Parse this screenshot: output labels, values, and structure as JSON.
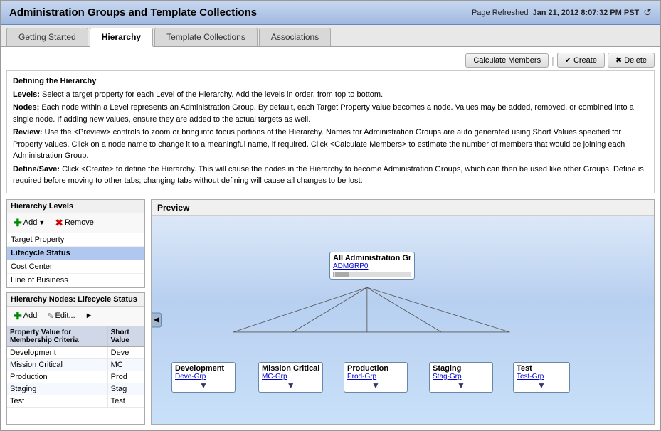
{
  "titleBar": {
    "title": "Administration Groups and Template Collections",
    "pageRefreshed": "Page Refreshed",
    "timestamp": "Jan 21, 2012  8:07:32 PM PST"
  },
  "tabs": [
    {
      "id": "getting-started",
      "label": "Getting Started",
      "active": false
    },
    {
      "id": "hierarchy",
      "label": "Hierarchy",
      "active": true
    },
    {
      "id": "template-collections",
      "label": "Template Collections",
      "active": false
    },
    {
      "id": "associations",
      "label": "Associations",
      "active": false
    }
  ],
  "description": {
    "title": "Defining the Hierarchy",
    "lines": [
      {
        "bold": "Levels:",
        "text": " Select a target property for each Level of the Hierarchy. Add the levels in order, from top to bottom."
      },
      {
        "bold": "Nodes:",
        "text": " Each node within a Level represents an Administration Group. By default, each Target Property value becomes a node. Values may be added, removed, or combined into a single node. If adding new values, ensure they are added to the actual targets as well."
      },
      {
        "bold": "Review:",
        "text": " Use the <Preview> controls to zoom or bring into focus portions of the Hierarchy. Names for Administration Groups are auto generated using Short Values specified for Property values. Click on a node name to change it to a meaningful name, if required. Click <Calculate Members> to estimate the number of members that would be joining each Administration Group."
      },
      {
        "bold": "Define/Save:",
        "text": " Click <Create> to define the Hierarchy. This will cause the nodes in the Hierarchy to become Administration Groups, which can then be used like other Groups. Define is required before moving to other tabs; changing tabs without defining will cause all changes to be lost."
      }
    ]
  },
  "actionButtons": {
    "calculate": "Calculate Members",
    "create": "Create",
    "delete": "Delete"
  },
  "hierarchyLevels": {
    "title": "Hierarchy Levels",
    "addLabel": "Add",
    "removeLabel": "Remove",
    "items": [
      {
        "label": "Target Property",
        "selected": false
      },
      {
        "label": "Lifecycle Status",
        "selected": true
      },
      {
        "label": "Cost Center",
        "selected": false
      },
      {
        "label": "Line of Business",
        "selected": false
      }
    ]
  },
  "hierarchyNodes": {
    "title": "Hierarchy Nodes: Lifecycle Status",
    "addLabel": "Add",
    "editLabel": "Edit...",
    "columns": [
      "Property Value for Membership Criteria",
      "Short Value"
    ],
    "rows": [
      {
        "property": "Development",
        "short": "Deve"
      },
      {
        "property": "Mission Critical",
        "short": "MC"
      },
      {
        "property": "Production",
        "short": "Prod"
      },
      {
        "property": "Staging",
        "short": "Stag"
      },
      {
        "property": "Test",
        "short": "Test"
      }
    ]
  },
  "preview": {
    "title": "Preview",
    "rootNode": {
      "title": "All Administration Gr",
      "subtitle": "ADMGRP0"
    },
    "childNodes": [
      {
        "title": "Development",
        "subtitle": "Deve-Grp"
      },
      {
        "title": "Mission Critical",
        "subtitle": "MC-Grp"
      },
      {
        "title": "Production",
        "subtitle": "Prod-Grp"
      },
      {
        "title": "Staging",
        "subtitle": "Stag-Grp"
      },
      {
        "title": "Test",
        "subtitle": "Test-Grp"
      }
    ]
  }
}
